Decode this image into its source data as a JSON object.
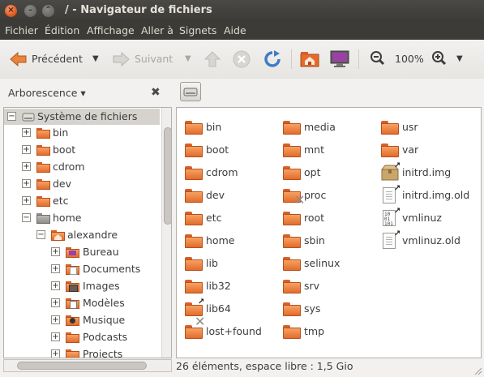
{
  "window": {
    "title": "/ - Navigateur de fichiers",
    "close_glyph": "×",
    "min_glyph": "–",
    "max_glyph": "⌃"
  },
  "menu": [
    "Fichier",
    "Édition",
    "Affichage",
    "Aller à",
    "Signets",
    "Aide"
  ],
  "toolbar": {
    "back_label": "Précédent",
    "forward_label": "Suivant",
    "zoom_level": "100%",
    "dropdown_glyph": "▼"
  },
  "sidebar": {
    "header_label": "Arborescence",
    "header_arrow": "▾",
    "close_glyph": "✖",
    "tree": [
      {
        "label": "Système de fichiers",
        "expander": "−",
        "icon": "drive-icon"
      },
      {
        "label": "bin",
        "expander": "+",
        "icon": "folder-icon"
      },
      {
        "label": "boot",
        "expander": "+",
        "icon": "folder-icon"
      },
      {
        "label": "cdrom",
        "expander": "+",
        "icon": "folder-icon"
      },
      {
        "label": "dev",
        "expander": "+",
        "icon": "folder-icon"
      },
      {
        "label": "etc",
        "expander": "+",
        "icon": "folder-icon"
      },
      {
        "label": "home",
        "expander": "−",
        "icon": "folder-gray-icon"
      },
      {
        "label": "alexandre",
        "expander": "−",
        "icon": "home-folder-icon"
      },
      {
        "label": "Bureau",
        "expander": "+",
        "icon": "desktop-folder-icon"
      },
      {
        "label": "Documents",
        "expander": "+",
        "icon": "documents-folder-icon"
      },
      {
        "label": "Images",
        "expander": "+",
        "icon": "pictures-folder-icon"
      },
      {
        "label": "Modèles",
        "expander": "+",
        "icon": "templates-folder-icon"
      },
      {
        "label": "Musique",
        "expander": "+",
        "icon": "music-folder-icon"
      },
      {
        "label": "Podcasts",
        "expander": "+",
        "icon": "folder-icon"
      },
      {
        "label": "Projects",
        "expander": "+",
        "icon": "folder-icon"
      }
    ]
  },
  "files": [
    {
      "name": "bin",
      "type": "folder"
    },
    {
      "name": "boot",
      "type": "folder"
    },
    {
      "name": "cdrom",
      "type": "folder"
    },
    {
      "name": "dev",
      "type": "folder"
    },
    {
      "name": "etc",
      "type": "folder"
    },
    {
      "name": "home",
      "type": "folder"
    },
    {
      "name": "lib",
      "type": "folder"
    },
    {
      "name": "lib32",
      "type": "folder"
    },
    {
      "name": "lib64",
      "type": "folder-link"
    },
    {
      "name": "lost+found",
      "type": "folder-broken"
    },
    {
      "name": "media",
      "type": "folder"
    },
    {
      "name": "mnt",
      "type": "folder"
    },
    {
      "name": "opt",
      "type": "folder"
    },
    {
      "name": "proc",
      "type": "folder-broken"
    },
    {
      "name": "root",
      "type": "folder"
    },
    {
      "name": "sbin",
      "type": "folder"
    },
    {
      "name": "selinux",
      "type": "folder"
    },
    {
      "name": "srv",
      "type": "folder"
    },
    {
      "name": "sys",
      "type": "folder"
    },
    {
      "name": "tmp",
      "type": "folder"
    },
    {
      "name": "usr",
      "type": "folder"
    },
    {
      "name": "var",
      "type": "folder"
    },
    {
      "name": "initrd.img",
      "type": "archive-link"
    },
    {
      "name": "initrd.img.old",
      "type": "file-link"
    },
    {
      "name": "vmlinuz",
      "type": "binary-link"
    },
    {
      "name": "vmlinuz.old",
      "type": "file-link"
    }
  ],
  "statusbar": {
    "text": "26 éléments, espace libre : 1,5 Gio"
  },
  "colors": {
    "titlebar": "#3c3b37",
    "folder_orange": "#e36c2c",
    "close_button": "#e05a1f"
  }
}
